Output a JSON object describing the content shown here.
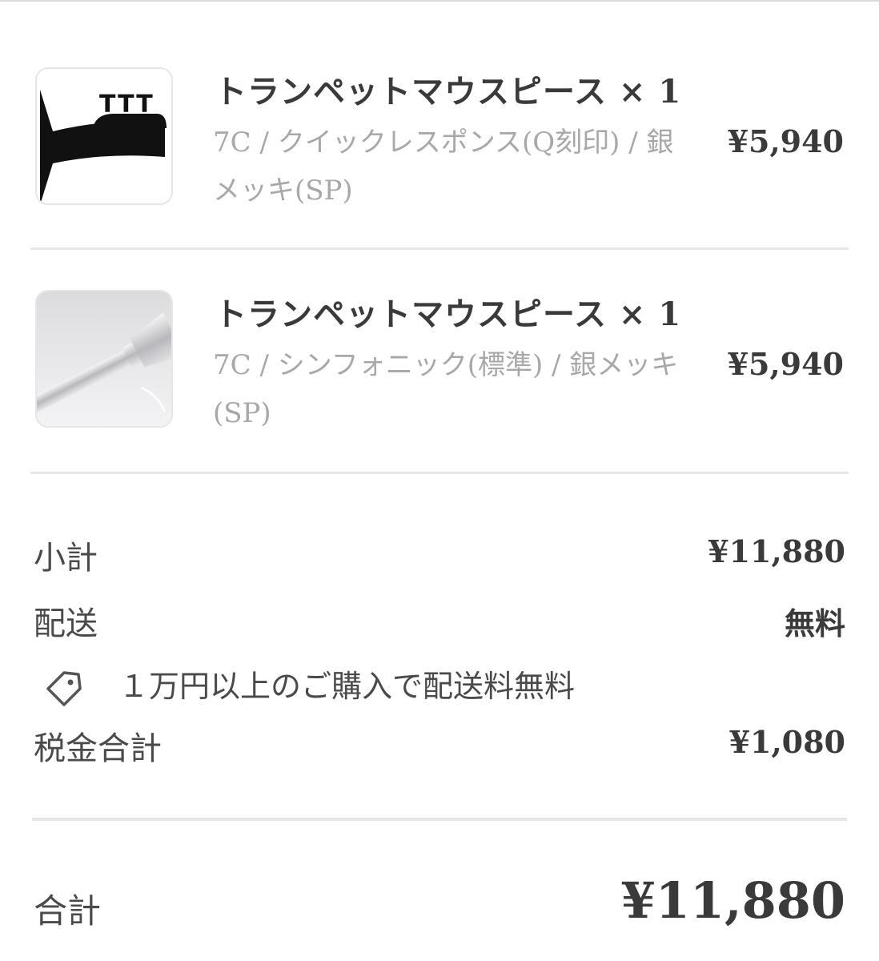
{
  "items": [
    {
      "title": "トランペットマウスピース × 1",
      "variant": "7C / クイックレスポンス(Q刻印) / 銀メッキ(SP)",
      "price": "¥5,940",
      "thumbnail_icon": "ttt-brand-logo",
      "thumbnail_logo_text": "TTT"
    },
    {
      "title": "トランペットマウスピース × 1",
      "variant": "7C / シンフォニック(標準) / 銀メッキ(SP)",
      "price": "¥5,940",
      "thumbnail_icon": "silver-mouthpiece-photo"
    }
  ],
  "summary": {
    "subtotal_label": "小計",
    "subtotal_value": "¥11,880",
    "shipping_label": "配送",
    "shipping_value": "無料",
    "shipping_note": "１万円以上のご購入で配送料無料",
    "shipping_note_icon": "tag-icon",
    "tax_label": "税金合計",
    "tax_value": "¥1,080"
  },
  "total": {
    "label": "合計",
    "value": "¥11,880"
  }
}
